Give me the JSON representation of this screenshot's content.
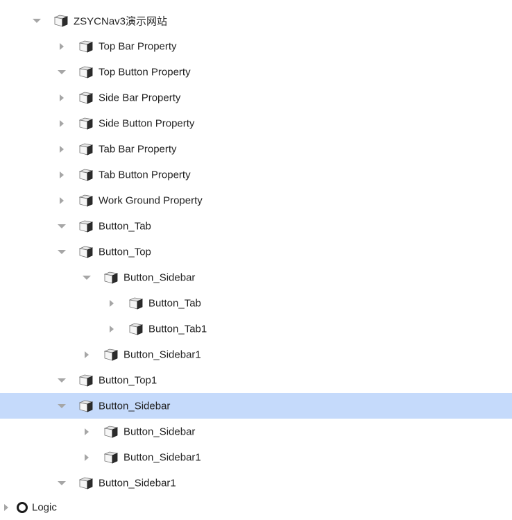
{
  "tree": {
    "items": [
      {
        "label": "ZSYCNav3演示网站",
        "level": 0,
        "state": "expanded",
        "icon": "cube-icon"
      },
      {
        "label": "Top Bar Property",
        "level": 1,
        "state": "collapsed",
        "icon": "cube-icon"
      },
      {
        "label": "Top Button Property",
        "level": 1,
        "state": "expanded",
        "icon": "cube-icon"
      },
      {
        "label": "Side Bar Property",
        "level": 1,
        "state": "collapsed",
        "icon": "cube-icon"
      },
      {
        "label": "Side Button Property",
        "level": 1,
        "state": "collapsed",
        "icon": "cube-icon"
      },
      {
        "label": "Tab Bar Property",
        "level": 1,
        "state": "collapsed",
        "icon": "cube-icon"
      },
      {
        "label": "Tab Button Property",
        "level": 1,
        "state": "collapsed",
        "icon": "cube-icon"
      },
      {
        "label": "Work Ground Property",
        "level": 1,
        "state": "collapsed",
        "icon": "cube-icon"
      },
      {
        "label": "Button_Tab",
        "level": 1,
        "state": "expanded",
        "icon": "cube-icon"
      },
      {
        "label": "Button_Top",
        "level": 1,
        "state": "expanded",
        "icon": "cube-icon"
      },
      {
        "label": "Button_Sidebar",
        "level": 2,
        "state": "expanded",
        "icon": "cube-icon"
      },
      {
        "label": "Button_Tab",
        "level": 3,
        "state": "collapsed",
        "icon": "cube-icon"
      },
      {
        "label": "Button_Tab1",
        "level": 3,
        "state": "collapsed",
        "icon": "cube-icon"
      },
      {
        "label": "Button_Sidebar1",
        "level": 2,
        "state": "collapsed",
        "icon": "cube-icon"
      },
      {
        "label": "Button_Top1",
        "level": 1,
        "state": "expanded",
        "icon": "cube-icon"
      },
      {
        "label": "Button_Sidebar",
        "level": 1,
        "state": "expanded",
        "icon": "cube-icon",
        "selected": true
      },
      {
        "label": "Button_Sidebar",
        "level": 2,
        "state": "collapsed",
        "icon": "cube-icon"
      },
      {
        "label": "Button_Sidebar1",
        "level": 2,
        "state": "collapsed",
        "icon": "cube-icon"
      },
      {
        "label": "Button_Sidebar1",
        "level": 1,
        "state": "expanded",
        "icon": "cube-icon"
      }
    ],
    "logic": {
      "label": "Logic",
      "state": "collapsed",
      "icon": "logic-ring-icon"
    }
  },
  "colors": {
    "selected_bg": "#c5dafb",
    "arrow": "#a6a6a6",
    "text": "#222222"
  }
}
